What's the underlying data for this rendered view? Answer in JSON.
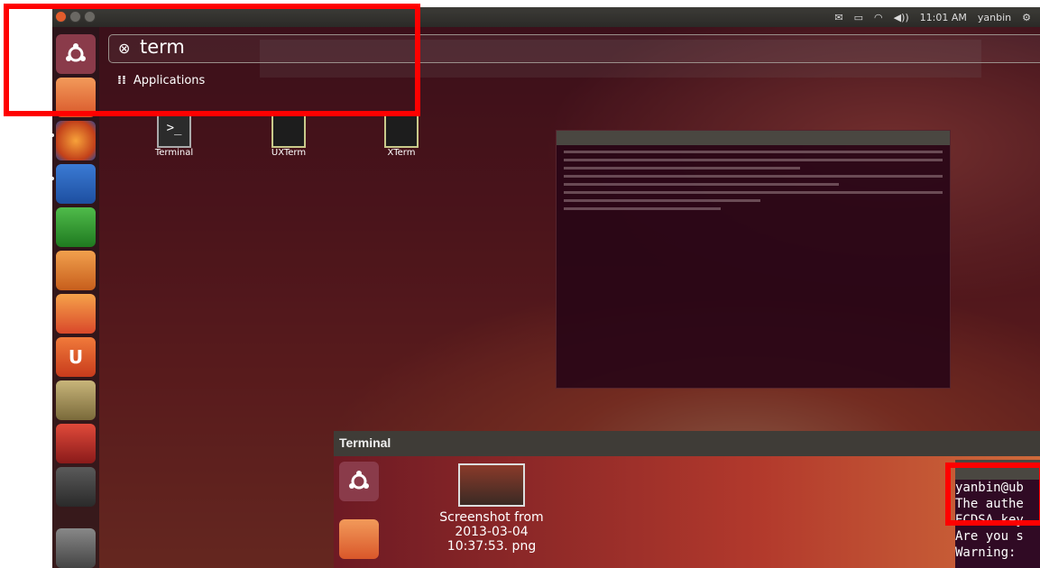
{
  "topbar": {
    "indicators": [
      "✉",
      "▭",
      "◠",
      "◀))",
      "11:01 AM",
      "yanbin",
      "⚙"
    ]
  },
  "search": {
    "value": "term",
    "clear_icon": "⊗"
  },
  "category": {
    "label": "Applications",
    "icon": "applications-icon"
  },
  "results": [
    {
      "label": "Terminal",
      "icon": "terminal-icon"
    },
    {
      "label": "UXTerm",
      "icon": "uxterm-icon"
    },
    {
      "label": "XTerm",
      "icon": "xterm-icon"
    }
  ],
  "preview": {
    "title": "Terminal",
    "file": "Screenshot from 2013-03-04 10:37:53. png",
    "terminal_lines": [
      "yanbin@ub",
      "The authe",
      "ECDSA key",
      "Are you s",
      "Warning:"
    ]
  },
  "colors": {
    "highlight": "#ff0000",
    "launcher_bg": "#2a1419"
  }
}
